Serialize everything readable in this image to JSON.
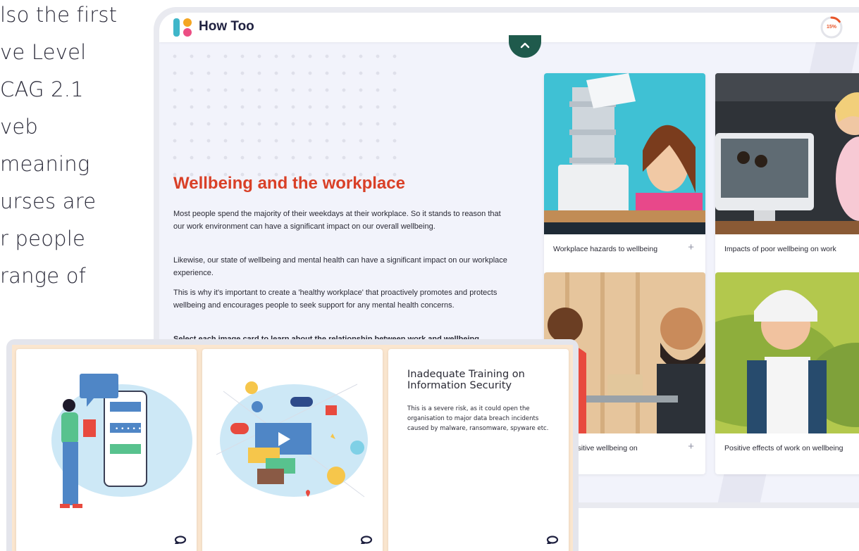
{
  "background_text": {
    "lines": [
      "lso the first",
      "ve Level",
      "CAG 2.1",
      "veb",
      "meaning",
      "urses are",
      "r people",
      "range of"
    ]
  },
  "app": {
    "logo_text": "How Too",
    "progress_label": "15%",
    "progress_value": 0.15,
    "accent_color": "#d94027",
    "scroll_up_icon": "chevron-up-icon"
  },
  "content": {
    "title": "Wellbeing and the workplace",
    "paragraphs": [
      "Most people spend the majority of their weekdays at their workplace. So it stands to reason that our work environment can have a significant impact on our overall wellbeing.",
      "Likewise, our state of wellbeing and mental health can have a significant impact on our workplace experience.",
      "This is why it's important to create a 'healthy workplace' that proactively promotes and protects wellbeing and encourages people to seek support for any mental health concerns.",
      "Select each image card to learn about the relationship between work and wellbeing."
    ]
  },
  "cards": [
    {
      "caption": "Workplace hazards to wellbeing",
      "icon": "plus-icon"
    },
    {
      "caption": "Impacts of poor wellbeing on work",
      "icon": "plus-icon"
    },
    {
      "caption": "ts of positive wellbeing on",
      "icon": "plus-icon"
    },
    {
      "caption": "Positive effects of work on wellbeing",
      "icon": "plus-icon"
    }
  ],
  "flip_cards": {
    "card3_title": "Inadequate Training on Information Security",
    "card3_body": "This is a severe risk, as it could open the organisation to major data breach incidents caused by malware, ransomware, spyware etc.",
    "flip_icon": "flip-icon"
  }
}
